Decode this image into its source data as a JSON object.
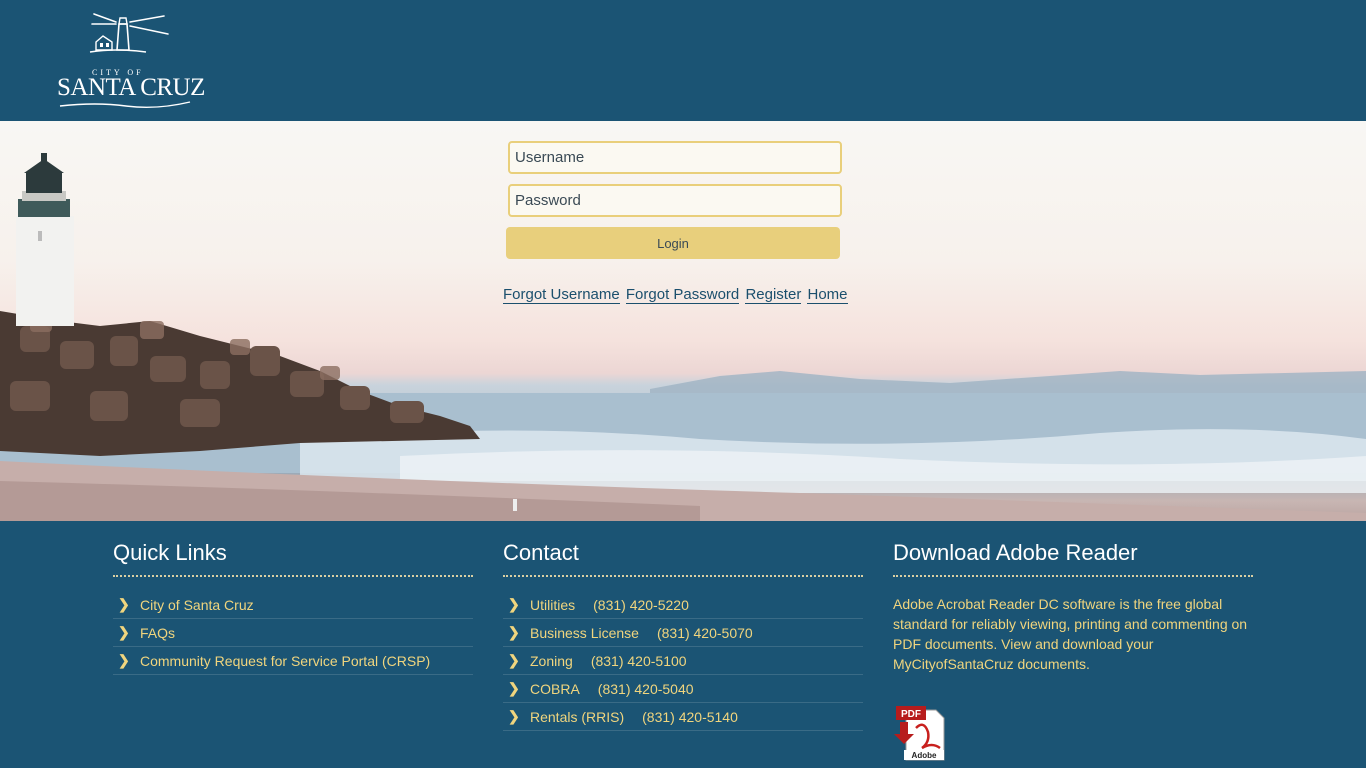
{
  "header": {
    "logo_city": "CITY OF",
    "logo_name": "SANTA CRUZ"
  },
  "login": {
    "username_placeholder": "Username",
    "password_placeholder": "Password",
    "login_label": "Login",
    "links": [
      "Forgot Username",
      "Forgot Password",
      "Register",
      "Home"
    ]
  },
  "quick_links": {
    "title": "Quick Links",
    "items": [
      "City of Santa Cruz",
      "FAQs",
      "Community Request for Service Portal (CRSP)"
    ]
  },
  "contact": {
    "title": "Contact",
    "items": [
      {
        "name": "Utilities",
        "phone": "(831) 420-5220"
      },
      {
        "name": "Business License",
        "phone": "(831) 420-5070"
      },
      {
        "name": "Zoning",
        "phone": "(831) 420-5100"
      },
      {
        "name": "COBRA",
        "phone": "(831) 420-5040"
      },
      {
        "name": "Rentals (RRIS)",
        "phone": "(831) 420-5140"
      }
    ]
  },
  "adobe": {
    "title": "Download Adobe Reader",
    "text": "Adobe Acrobat Reader DC software is the free global standard for reliably viewing, printing and commenting on PDF documents. View and download your MyCityofSantaCruz documents.",
    "icon_label_top": "PDF",
    "icon_label_bottom": "Adobe"
  },
  "colors": {
    "header_bg": "#1b5474",
    "accent": "#e8cf7c",
    "link_text": "#f0d57e"
  }
}
